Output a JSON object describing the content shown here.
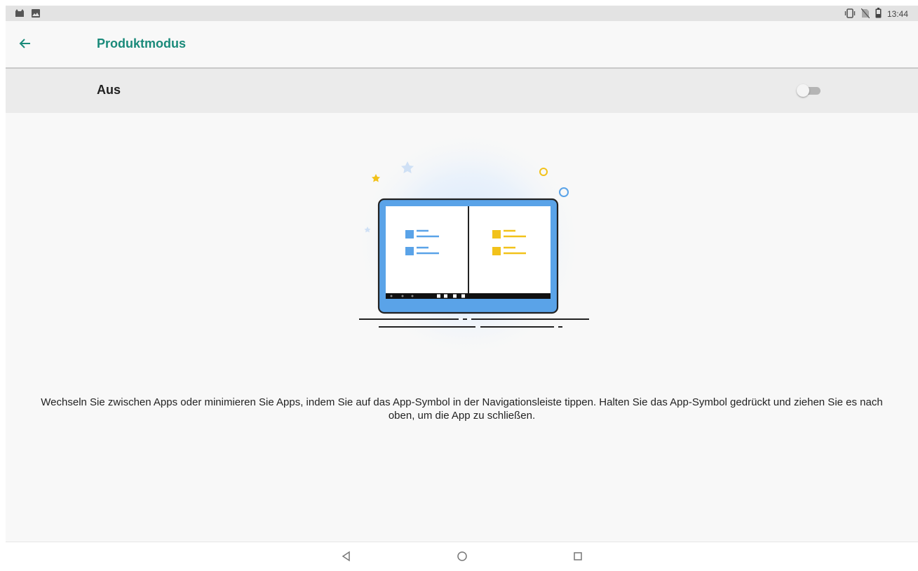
{
  "status_bar": {
    "time": "13:44",
    "left_icons": [
      "cat-icon",
      "image-icon"
    ],
    "right_icons": [
      "vibrate-icon",
      "no-sim-icon",
      "battery-icon"
    ]
  },
  "app_bar": {
    "back_icon": "arrow-back-icon",
    "title": "Produktmodus"
  },
  "toggle": {
    "label": "Aus",
    "state": "off"
  },
  "illustration": {
    "subject": "tablet-split-screen-icon"
  },
  "description": {
    "text": "Wechseln Sie zwischen Apps oder minimieren Sie Apps, indem Sie auf das App-Symbol in der Navigationsleiste tippen. Halten Sie das App-Symbol gedrückt und ziehen Sie es nach oben, um die App zu schließen."
  },
  "nav_bar": {
    "buttons": [
      "back-triangle-icon",
      "home-circle-icon",
      "recents-square-icon"
    ]
  },
  "colors": {
    "accent": "#1a8a7a",
    "illustration_blue": "#5aa3e8",
    "illustration_yellow": "#f2c21b"
  }
}
